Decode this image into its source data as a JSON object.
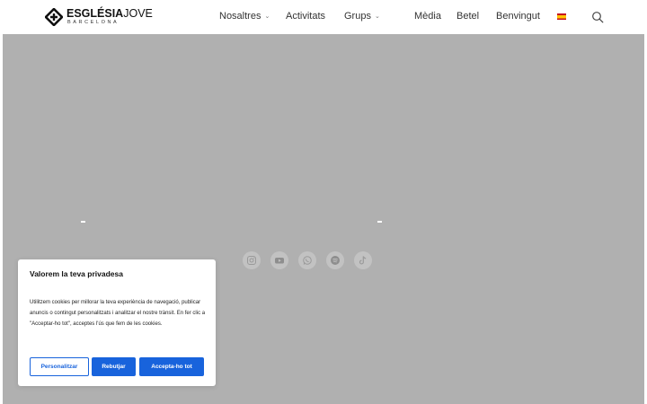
{
  "brand": {
    "name_bold": "ESGLÉSIA",
    "name_light": "JOVE",
    "subtitle": "BARCELONA"
  },
  "nav": {
    "items": [
      {
        "label": "Nosaltres",
        "dropdown": true
      },
      {
        "label": "Activitats",
        "dropdown": false
      },
      {
        "label": "Grups",
        "dropdown": true
      },
      {
        "label": "Mèdia",
        "dropdown": false
      },
      {
        "label": "Betel",
        "dropdown": false
      },
      {
        "label": "Benvingut",
        "dropdown": false
      }
    ],
    "chevron": "⌄",
    "language_icon": "flag-es",
    "search_icon": "search-icon"
  },
  "hero": {
    "background": "#b0b0b0",
    "socials": [
      "instagram-icon",
      "youtube-icon",
      "whatsapp-icon",
      "spotify-icon",
      "tiktok-icon"
    ]
  },
  "cookie": {
    "title": "Valorem la teva privadesa",
    "body": "Utilitzem cookies per millorar la teva experiència de navegació, publicar anuncis o contingut personalitzats i analitzar el nostre trànsit. En fer clic a \"Acceptar-ho tot\", acceptes l'ús que fem de les cookies.",
    "customize_label": "Personalitzar",
    "reject_label": "Rebutjar",
    "accept_label": "Accepta-ho tot",
    "accent": "#1863dc"
  }
}
